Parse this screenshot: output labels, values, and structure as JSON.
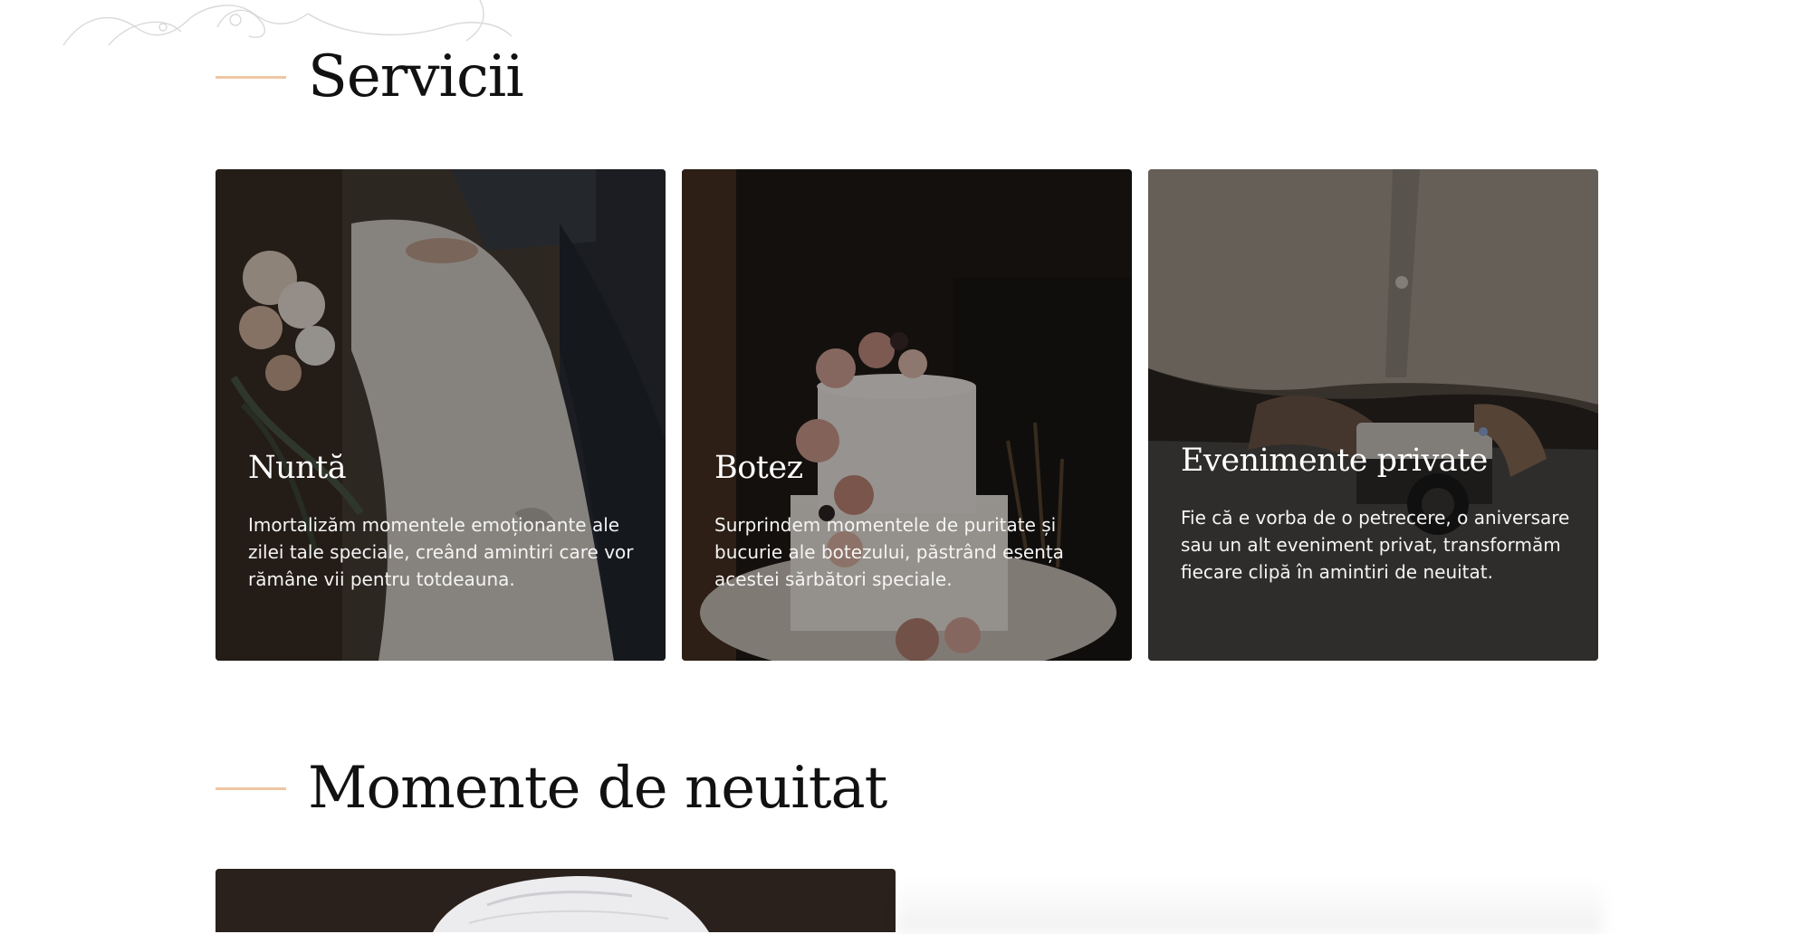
{
  "colors": {
    "accent": "#efc6a4",
    "heading": "#111111",
    "card_overlay": "rgba(0,0,0,0.38)"
  },
  "services": {
    "heading": "Servicii",
    "cards": [
      {
        "title": "Nuntă",
        "description": "Imortalizăm momentele emoționante ale zilei tale speciale, creând amintiri care vor rămâne vii pentru totdeauna."
      },
      {
        "title": "Botez",
        "description": "Surprindem momentele de puritate și bucurie ale botezului, păstrând esența acestei sărbători speciale."
      },
      {
        "title": "Evenimente private",
        "description": "Fie că e vorba de o petrecere, o aniversare sau un alt eveniment privat, transformăm fiecare clipă în amintiri de neuitat."
      }
    ]
  },
  "moments": {
    "heading": "Momente de neuitat"
  }
}
